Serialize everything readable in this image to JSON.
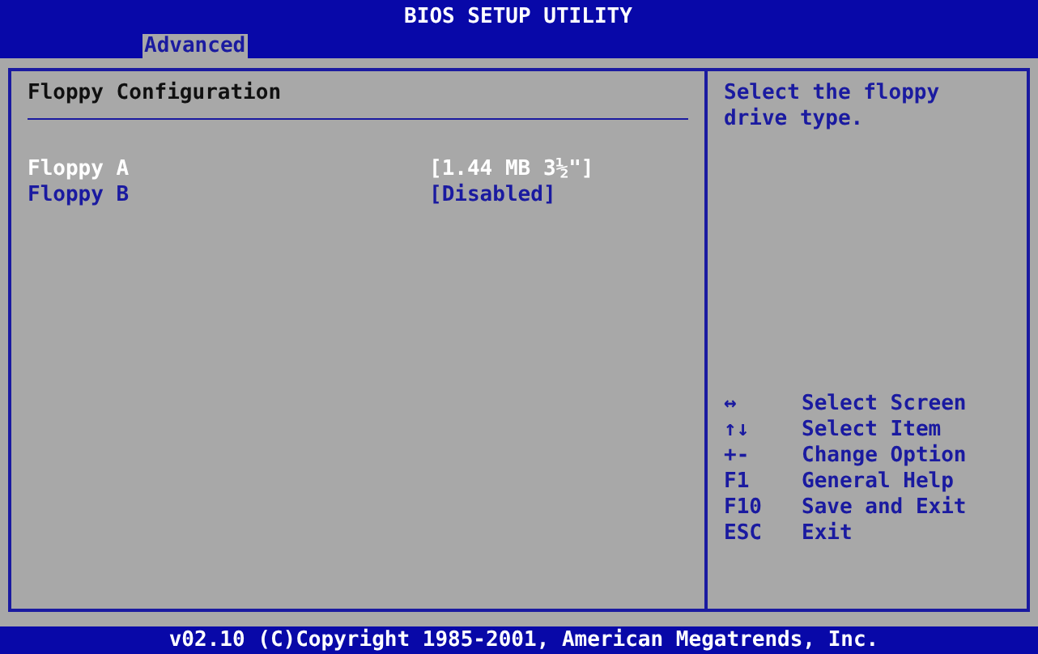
{
  "window": {
    "title": "BIOS SETUP UTILITY"
  },
  "tabs": [
    {
      "label": "Advanced",
      "selected": true
    }
  ],
  "panel": {
    "title": "Floppy Configuration",
    "settings": [
      {
        "label": "Floppy A",
        "value": "[1.44 MB 3½\"]",
        "selected": true
      },
      {
        "label": "Floppy B",
        "value": "[Disabled]",
        "selected": false
      }
    ]
  },
  "help": {
    "text": "Select the floppy drive type.",
    "keys": [
      {
        "key": "↔",
        "action": "Select Screen"
      },
      {
        "key": "↑↓",
        "action": "Select Item"
      },
      {
        "key": "+-",
        "action": "Change Option"
      },
      {
        "key": "F1",
        "action": "General Help"
      },
      {
        "key": "F10",
        "action": "Save and Exit"
      },
      {
        "key": "ESC",
        "action": "Exit"
      }
    ]
  },
  "status_bar": "v02.10 (C)Copyright 1985-2001, American Megatrends, Inc."
}
